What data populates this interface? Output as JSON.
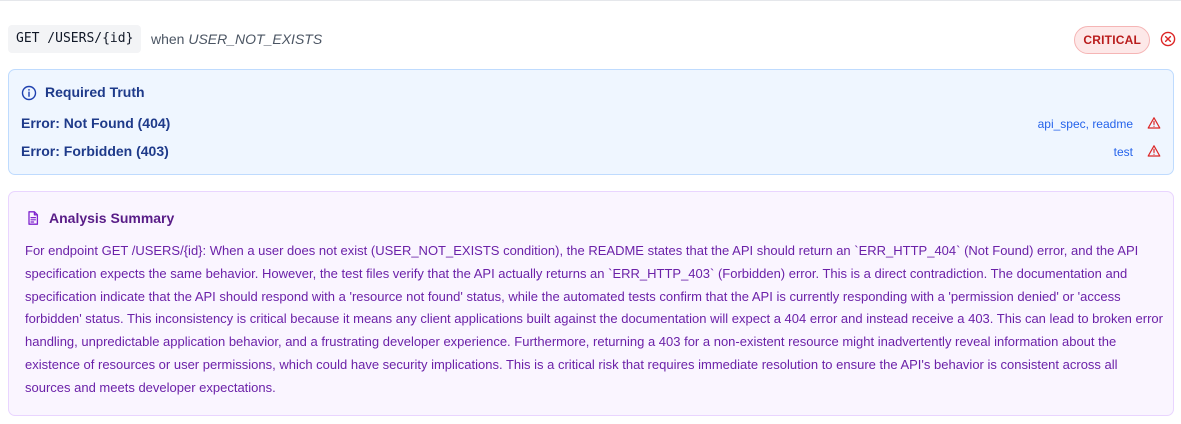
{
  "header": {
    "endpoint": "GET /USERS/{id}",
    "condition_prefix": "when",
    "condition": "USER_NOT_EXISTS",
    "severity": "CRITICAL"
  },
  "required_truth": {
    "title": "Required Truth",
    "items": [
      {
        "label": "Error: Not Found (404)",
        "sources": "api_spec, readme"
      },
      {
        "label": "Error: Forbidden (403)",
        "sources": "test"
      }
    ]
  },
  "analysis": {
    "title": "Analysis Summary",
    "text": "For endpoint GET /USERS/{id}: When a user does not exist (USER_NOT_EXISTS condition), the README states that the API should return an `ERR_HTTP_404` (Not Found) error, and the API specification expects the same behavior. However, the test files verify that the API actually returns an `ERR_HTTP_403` (Forbidden) error. This is a direct contradiction. The documentation and specification indicate that the API should respond with a 'resource not found' status, while the automated tests confirm that the API is currently responding with a 'permission denied' or 'access forbidden' status. This inconsistency is critical because it means any client applications built against the documentation will expect a 404 error and instead receive a 403. This can lead to broken error handling, unpredictable application behavior, and a frustrating developer experience. Furthermore, returning a 403 for a non-existent resource might inadvertently reveal information about the existence of resources or user permissions, which could have security implications. This is a critical risk that requires immediate resolution to ensure the API's behavior is consistent across all sources and meets developer expectations."
  },
  "icons": {
    "close": "close-circle-icon",
    "info": "info-icon",
    "warning": "warning-triangle-icon",
    "document": "document-icon"
  },
  "colors": {
    "critical_text": "#b91c1c",
    "critical_bg": "#fde8e8",
    "truth_bg": "#eff6ff",
    "truth_text": "#1e3a8a",
    "source_link": "#2563eb",
    "summary_bg": "#faf5ff",
    "summary_text": "#6b21a8"
  }
}
